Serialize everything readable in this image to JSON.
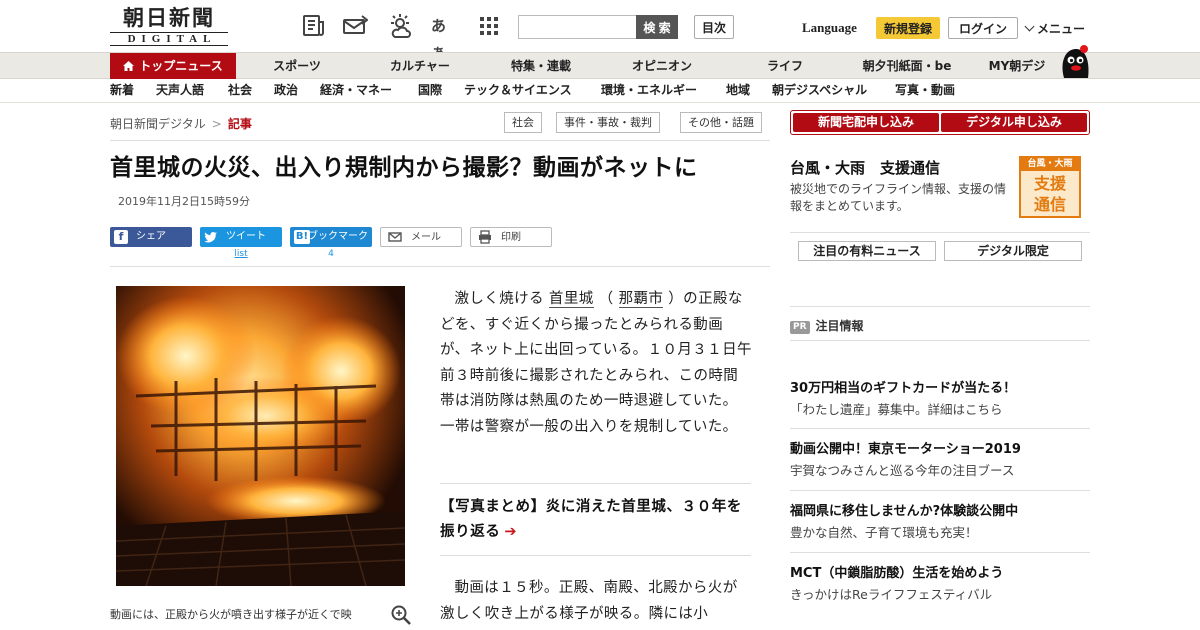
{
  "header": {
    "logo_kanji": "朝日新聞",
    "logo_roman": "DIGITAL",
    "icons": [
      "newspaper-icon",
      "mail-icon",
      "weather-icon",
      "font-size-icon",
      "grid-icon"
    ],
    "font_size_glyph": "あぁ",
    "search_placeholder": "",
    "search_button": "検 索",
    "toc_button": "目次",
    "language": "Language",
    "register_button": "新規登録",
    "login_button": "ログイン",
    "menu_button": "メニュー"
  },
  "main_nav": [
    "トップニュース",
    "スポーツ",
    "カルチャー",
    "特集・連載",
    "オピニオン",
    "ライフ",
    "朝夕刊紙面・be",
    "MY朝デジ"
  ],
  "sub_nav": [
    "新着",
    "天声人語",
    "社会",
    "政治",
    "経済・マネー",
    "国際",
    "テック＆サイエンス",
    "環境・エネルギー",
    "地域",
    "朝デジスペシャル",
    "写真・動画"
  ],
  "breadcrumb": {
    "home": "朝日新聞デジタル",
    "separator": ">",
    "current": "記事"
  },
  "tags": [
    "社会",
    "事件・事故・裁判",
    "その他・話題"
  ],
  "article": {
    "headline": "首里城の火災、出入り規制内から撮影？動画がネットに",
    "date": "2019年11月2日15時59分",
    "share": {
      "facebook": "シェア",
      "twitter": "ツイート",
      "twitter_count": "list",
      "hatena": "ブックマーク",
      "hatena_icon": "B!",
      "hatena_count": "4",
      "mail": "メール",
      "print": "印刷"
    },
    "photo_caption": "動画には、正殿から火が噴き出す様子が近くで映",
    "body1_pre": "激しく焼ける",
    "body1_link1": "首里城",
    "body1_mid": "（",
    "body1_link2": "那覇市",
    "body1_post": "）の正殿などを、すぐ近くから撮ったとみられる動画が、ネット上に出回っている。１０月３１日午前３時前後に撮影されたとみられ、この時間帯は消防隊は熱風のため一時退避していた。一帯は警察が一般の出入りを規制していた。",
    "related_link": "【写真まとめ】炎に消えた首里城、３０年を振り返る",
    "related_arrow": "➔",
    "body2": "動画は１５秒。正殿、南殿、北殿から火が激しく吹き上がる様子が映る。隣には小"
  },
  "sidebar": {
    "subscribe_paper": "新聞宅配申し込み",
    "subscribe_digital": "デジタル申し込み",
    "typhoon_title": "台風・大雨　支援通信",
    "typhoon_desc": "被災地でのライフライン情報、支援の情報をまとめています。",
    "typhoon_badge_top": "台風・大雨",
    "typhoon_badge_main1": "支援",
    "typhoon_badge_main2": "通信",
    "tab_paid": "注目の有料ニュース",
    "tab_digital": "デジタル限定",
    "pr_label": "PR",
    "pr_heading": "注目情報",
    "ads": [
      {
        "title": "30万円相当のギフトカードが当たる！",
        "desc": "「わたし遺産」募集中。詳細はこちら"
      },
      {
        "title": "動画公開中！東京モーターショー2019",
        "desc": "宇賀なつみさんと巡る今年の注目ブース"
      },
      {
        "title": "福岡県に移住しませんか?体験談公開中",
        "desc": "豊かな自然、子育て環境も充実！"
      },
      {
        "title": "MCT（中鎖脂肪酸）生活を始めよう",
        "desc": "きっかけはReライフフェスティバル"
      }
    ]
  },
  "colors": {
    "brand_red": "#b30b13",
    "register_yellow": "#f4c935",
    "facebook": "#3b5998",
    "twitter": "#1b95e0",
    "hatena": "#1e88d3",
    "typhoon_orange": "#e37b10"
  }
}
